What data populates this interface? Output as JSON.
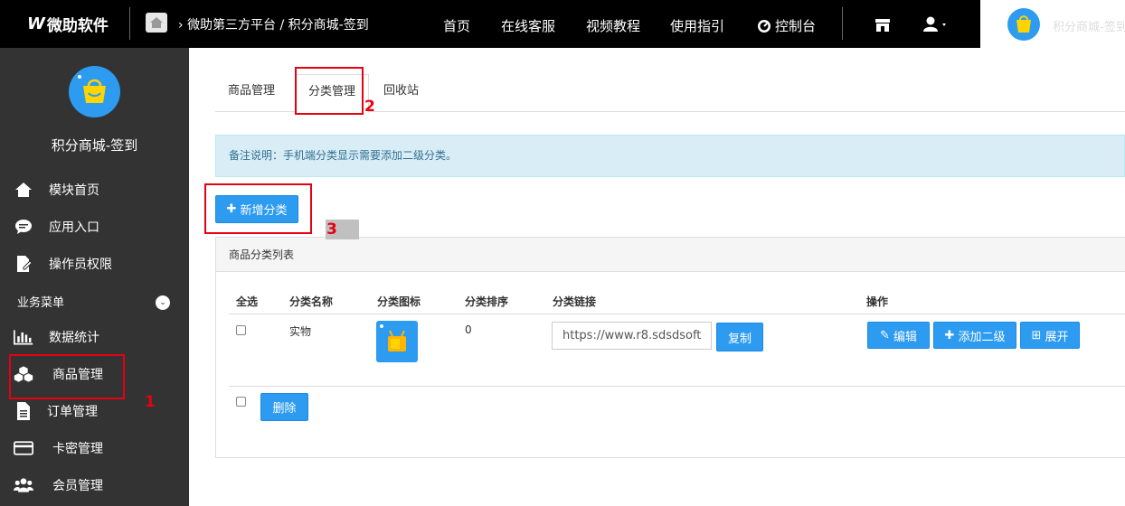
{
  "topbar": {
    "logo_text": "微助软件",
    "breadcrumb": "微助第三方平台 / 积分商城-签到",
    "nav": [
      "首页",
      "在线客服",
      "视频教程",
      "使用指引",
      "控制台"
    ],
    "account_name": "积分商城-签到"
  },
  "sidebar": {
    "shop_name": "积分商城-签到",
    "items": [
      {
        "label": "模块首页",
        "icon": "home-icon"
      },
      {
        "label": "应用入口",
        "icon": "chat-icon"
      },
      {
        "label": "操作员权限",
        "icon": "document-edit-icon"
      }
    ],
    "group_label": "业务菜单",
    "group_items": [
      {
        "label": "数据统计",
        "icon": "bar-chart-icon"
      },
      {
        "label": "商品管理",
        "icon": "cubes-icon"
      },
      {
        "label": "订单管理",
        "icon": "file-icon"
      },
      {
        "label": "卡密管理",
        "icon": "card-icon"
      },
      {
        "label": "会员管理",
        "icon": "users-icon"
      }
    ]
  },
  "tabs": [
    {
      "label": "商品管理",
      "active": false
    },
    {
      "label": "分类管理",
      "active": true
    },
    {
      "label": "回收站",
      "active": false
    }
  ],
  "notice": "备注说明：手机端分类显示需要添加二级分类。",
  "add_button": "新增分类",
  "panel": {
    "title": "商品分类列表",
    "columns": [
      "全选",
      "分类名称",
      "分类图标",
      "分类排序",
      "分类链接",
      "操作"
    ],
    "rows": [
      {
        "name": "实物",
        "sort": "0",
        "link": "https://www.r8.sdsdsoft",
        "copy": "复制",
        "actions": [
          "编辑",
          "添加二级",
          "展开"
        ]
      }
    ],
    "delete_button": "删除"
  },
  "annotations": {
    "one": "1",
    "two": "2",
    "three": "3"
  },
  "colors": {
    "primary": "#2d9bf0",
    "sidebar": "#333333",
    "annotation": "#e60012",
    "notice_bg": "#d9edf7"
  }
}
